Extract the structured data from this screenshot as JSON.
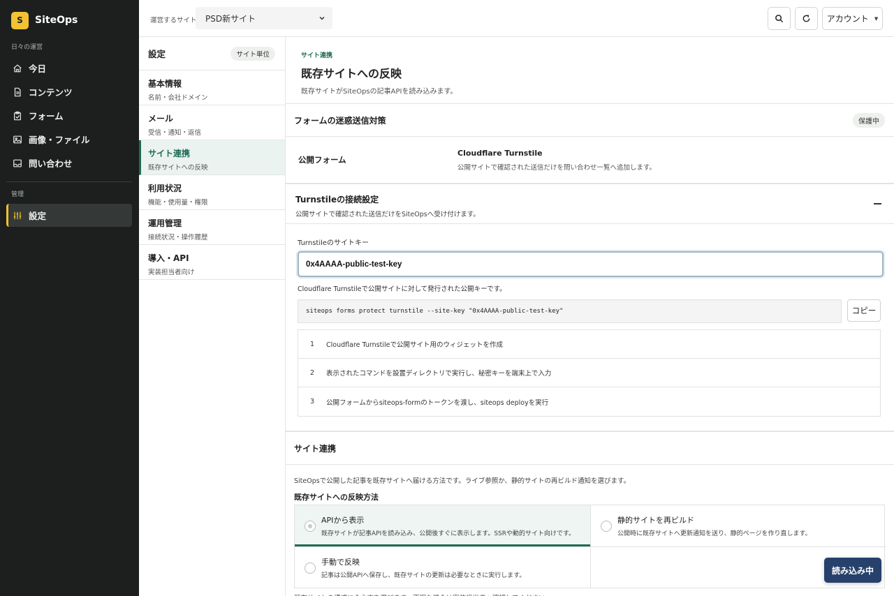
{
  "brand": {
    "logo_letter": "S",
    "name": "SiteOps"
  },
  "sidebar": {
    "section_daily": "日々の運営",
    "items": [
      {
        "label": "今日",
        "icon": "home-icon"
      },
      {
        "label": "コンテンツ",
        "icon": "document-icon"
      },
      {
        "label": "フォーム",
        "icon": "clipboard-icon"
      },
      {
        "label": "画像・ファイル",
        "icon": "image-icon"
      },
      {
        "label": "問い合わせ",
        "icon": "inbox-icon"
      }
    ],
    "section_admin": "管理",
    "admin_item": {
      "label": "設定",
      "icon": "sliders-icon"
    }
  },
  "topbar": {
    "site_label": "運営するサイト",
    "site_value": "PSD新サイト",
    "account_label": "アカウント"
  },
  "subnav": {
    "title": "設定",
    "scope_pill": "サイト単位",
    "items": [
      {
        "title": "基本情報",
        "sub": "名前・会社ドメイン"
      },
      {
        "title": "メール",
        "sub": "受信・通知・返信"
      },
      {
        "title": "サイト連携",
        "sub": "既存サイトへの反映"
      },
      {
        "title": "利用状況",
        "sub": "機能・使用量・権限"
      },
      {
        "title": "運用管理",
        "sub": "接続状況・操作履歴"
      },
      {
        "title": "導入・API",
        "sub": "実装担当者向け"
      }
    ]
  },
  "page": {
    "eyebrow": "サイト連携",
    "title": "既存サイトへの反映",
    "desc": "既存サイトがSiteOpsの記事APIを読み込みます。"
  },
  "spam": {
    "title": "フォームの迷惑送信対策",
    "badge": "保護中",
    "row_label": "公開フォーム",
    "row_value": "Cloudflare Turnstile",
    "row_desc": "公開サイトで確認された送信だけを問い合わせ一覧へ追加します。"
  },
  "turnstile": {
    "title": "Turnstileの接続設定",
    "desc": "公開サイトで確認された送信だけをSiteOpsへ受け付けます。",
    "field_label": "Turnstileのサイトキー",
    "field_value": "0x4AAAA-public-test-key",
    "help": "Cloudflare Turnstileで公開サイトに対して発行された公開キーです。",
    "command": "siteops forms protect turnstile --site-key \"0x4AAAA-public-test-key\"",
    "copy_label": "コピー",
    "steps": [
      {
        "n": "1",
        "text": "Cloudflare Turnstileで公開サイト用のウィジェットを作成"
      },
      {
        "n": "2",
        "text": "表示されたコマンドを設置ディレクトリで実行し、秘密キーを端末上で入力"
      },
      {
        "n": "3",
        "text": "公開フォームからsiteops-formのトークンを渡し、siteops deployを実行"
      }
    ]
  },
  "sync": {
    "title": "サイト連携",
    "desc": "SiteOpsで公開した記事を既存サイトへ届ける方法です。ライブ参照か、静的サイトの再ビルド通知を選びます。",
    "method_label": "既存サイトへの反映方法",
    "options": [
      {
        "title": "APIから表示",
        "desc": "既存サイトが記事APIを読み込み、公開後すぐに表示します。SSRや動的サイト向けです。",
        "selected": true
      },
      {
        "title": "静的サイトを再ビルド",
        "desc": "公開時に既存サイトへ更新通知を送り、静的ページを作り直します。",
        "selected": false
      },
      {
        "title": "手動で反映",
        "desc": "記事は公開APIへ保存し、既存サイトの更新は必要なときに実行します。",
        "selected": false
      }
    ],
    "footnote": "既存サイトの構成に合う方を選びます。不明な場合は実装担当者へ確認してください。"
  },
  "toast": {
    "label": "読み込み中"
  },
  "colors": {
    "accent": "#1f6b55",
    "brand_yellow": "#f2c233",
    "sidebar_bg": "#1c1f1e",
    "toast_bg": "#26416b"
  }
}
